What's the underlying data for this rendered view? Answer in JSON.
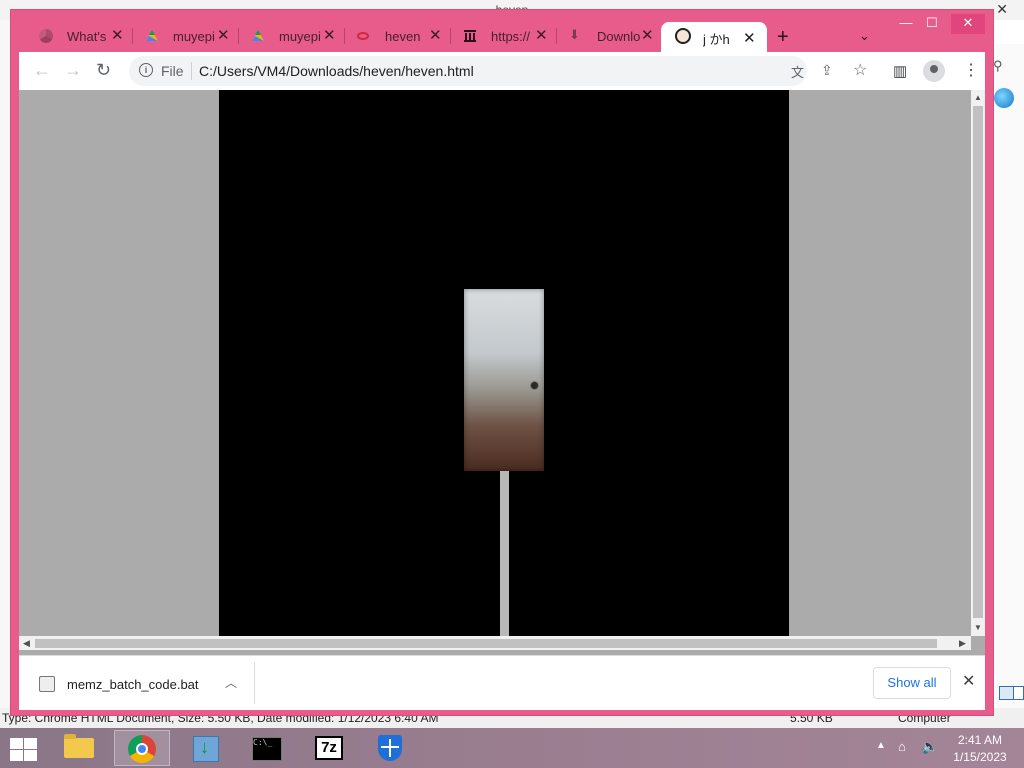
{
  "background_window": {
    "title": "heven",
    "status_type": "Type: Chrome HTML Document, Size: 5.50 KB, Date modified: 1/12/2023 6:40 AM",
    "status_size": "5.50 KB",
    "status_location": "Computer"
  },
  "tabs": [
    {
      "title": "What's",
      "icon": "chrome-icon"
    },
    {
      "title": "muyepi",
      "icon": "google-drive-icon"
    },
    {
      "title": "muyepi",
      "icon": "google-drive-icon"
    },
    {
      "title": "heven",
      "icon": "red-ring-icon"
    },
    {
      "title": "https://",
      "icon": "museum-icon"
    },
    {
      "title": "Downlo",
      "icon": "download-icon"
    },
    {
      "title": "j かh",
      "icon": "anime-face-icon",
      "active": true
    }
  ],
  "toolbar": {
    "file_label": "File",
    "url": "C:/Users/VM4/Downloads/heven/heven.html"
  },
  "downloads": {
    "filename": "memz_batch_code.bat",
    "show_all_label": "Show all"
  },
  "taskbar": {
    "apps": [
      "file-explorer",
      "chrome",
      "setup-installer",
      "command-prompt",
      "7-zip",
      "windows-defender"
    ],
    "clock_time": "2:41 AM",
    "clock_date": "1/15/2023"
  }
}
